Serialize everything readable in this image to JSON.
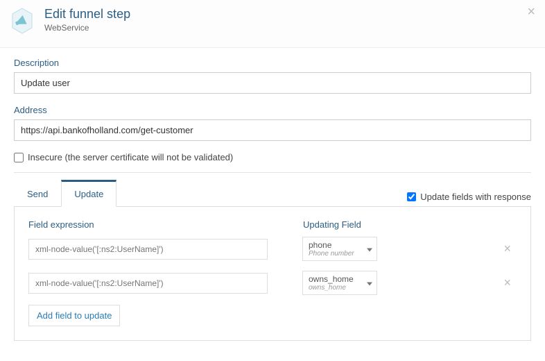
{
  "header": {
    "title": "Edit funnel step",
    "subtitle": "WebService"
  },
  "description": {
    "label": "Description",
    "value": "Update user"
  },
  "address": {
    "label": "Address",
    "value": "https://api.bankofholland.com/get-customer"
  },
  "insecure": {
    "checked": false,
    "label": "Insecure (the server certificate will not be validated)"
  },
  "tabs": {
    "send": "Send",
    "update": "Update",
    "updateResponse": {
      "checked": true,
      "label": "Update fields with response"
    }
  },
  "panel": {
    "fieldExprLabel": "Field expression",
    "updatingFieldLabel": "Updating Field",
    "exprPlaceholder": "xml-node-value('[:ns2:UserName]')",
    "rows": [
      {
        "field": "phone",
        "fieldSub": "Phone number"
      },
      {
        "field": "owns_home",
        "fieldSub": "owns_home"
      }
    ],
    "addLabel": "Add field to update"
  }
}
